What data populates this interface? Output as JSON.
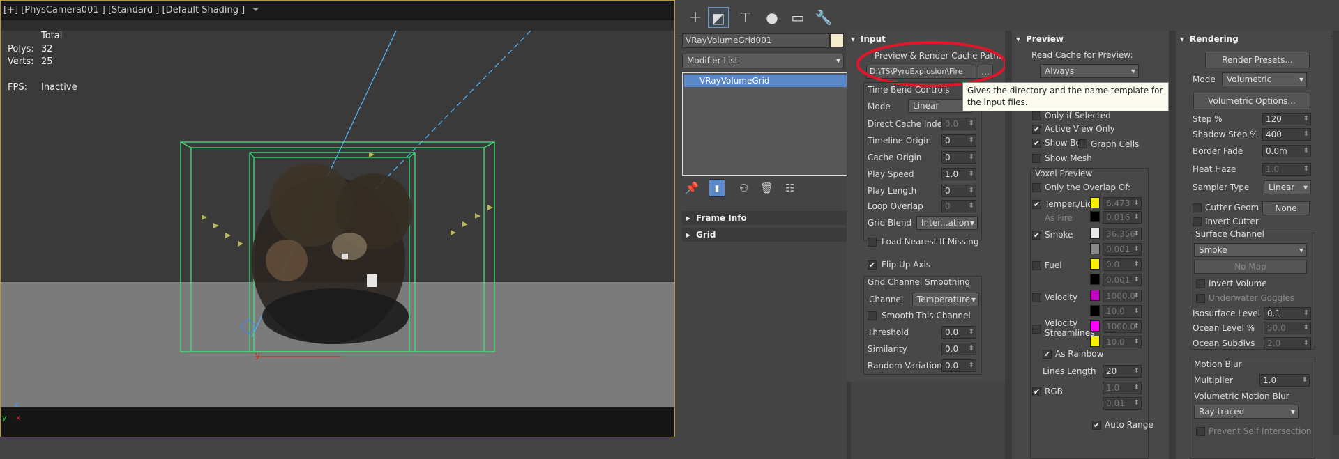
{
  "viewport": {
    "label": "[+] [PhysCamera001 ] [Standard ] [Default Shading ]",
    "stats_header": "Total",
    "polys_label": "Polys:",
    "polys": "32",
    "verts_label": "Verts:",
    "verts": "25",
    "fps_label": "FPS:",
    "fps": "Inactive",
    "axis_x": "x",
    "axis_y": "y",
    "axis_z": "z"
  },
  "modifier": {
    "object_name": "VRayVolumeGrid001",
    "color": "#f3ebcc",
    "list_label": "Modifier List",
    "stack_item": "VRayVolumeGrid",
    "rollouts": [
      "Frame Info",
      "Grid"
    ]
  },
  "input": {
    "title": "Input",
    "cache_path_label": "Preview & Render Cache Path:",
    "cache_path": "D:\\TS\\PyroExplosion\\Fire",
    "browse": "...",
    "tooltip": "Gives the directory and the name template for the input files.",
    "time_bend_title": "Time Bend Controls",
    "mode_label": "Mode",
    "mode": "Linear",
    "direct_cache_label": "Direct Cache Index",
    "direct_cache": "0.0",
    "timeline_origin_label": "Timeline Origin",
    "timeline_origin": "0",
    "cache_origin_label": "Cache Origin",
    "cache_origin": "0",
    "play_speed_label": "Play Speed",
    "play_speed": "1.0",
    "play_length_label": "Play Length",
    "play_length": "0",
    "loop_overlap_label": "Loop Overlap",
    "loop_overlap": "0",
    "grid_blend_label": "Grid Blend",
    "grid_blend": "Inter...ation",
    "load_nearest_label": "Load Nearest If Missing",
    "flip_up_label": "Flip Up Axis",
    "smoothing_title": "Grid Channel Smoothing",
    "channel_label": "Channel",
    "channel": "Temperature",
    "smooth_this_label": "Smooth This Channel",
    "threshold_label": "Threshold",
    "threshold": "0.0",
    "similarity_label": "Similarity",
    "similarity": "0.0",
    "random_var_label": "Random Variation",
    "random_var": "0.0"
  },
  "preview": {
    "title": "Preview",
    "read_cache_label": "Read Cache for Preview:",
    "read_cache": "Always",
    "only_if_selected": "Only if Selected",
    "active_view_only": "Active View Only",
    "show_box": "Show Box",
    "graph_cells": "Graph Cells",
    "show_mesh": "Show Mesh",
    "voxel_preview_title": "Voxel Preview",
    "only_overlap": "Only the Overlap Of:",
    "temper_label": "Temper./Liq.",
    "temper_val": "6.473",
    "as_fire": "As Fire",
    "as_fire_val": "0.016",
    "smoke_label": "Smoke",
    "smoke_val": "36.356",
    "smoke_val2": "0.001",
    "fuel_label": "Fuel",
    "fuel_val": "0.0",
    "fuel_val2": "0.001",
    "velocity_label": "Velocity",
    "velocity_val": "1000.0",
    "velocity_val2": "10.0",
    "vstream_label1": "Velocity",
    "vstream_label2": "Streamlines",
    "vstream_val": "1000.0",
    "vstream_val2": "10.0",
    "as_rainbow": "As Rainbow",
    "lines_length_label": "Lines Length",
    "lines_length": "20",
    "rgb_label": "RGB",
    "rgb_val": "1.0",
    "rgb_val2": "0.01",
    "auto_range": "Auto Range"
  },
  "rendering": {
    "title": "Rendering",
    "render_presets": "Render Presets...",
    "mode_label": "Mode",
    "mode": "Volumetric",
    "vol_options": "Volumetric Options...",
    "step_label": "Step %",
    "step": "120",
    "shadow_step_label": "Shadow Step %",
    "shadow_step": "400",
    "border_fade_label": "Border Fade",
    "border_fade": "0.0m",
    "heat_haze_label": "Heat Haze",
    "heat_haze": "1.0",
    "sampler_label": "Sampler Type",
    "sampler": "Linear",
    "cutter_geom_label": "Cutter Geom",
    "cutter_geom": "None",
    "invert_cutter": "Invert Cutter",
    "surface_channel_title": "Surface Channel",
    "surface_channel": "Smoke",
    "no_map": "No Map",
    "invert_volume": "Invert Volume",
    "underwater": "Underwater Goggles",
    "isosurface_label": "Isosurface Level",
    "isosurface": "0.1",
    "ocean_level_label": "Ocean Level %",
    "ocean_level": "50.0",
    "ocean_subdivs_label": "Ocean Subdivs",
    "ocean_subdivs": "2.0",
    "motion_blur_title": "Motion Blur",
    "multiplier_label": "Multiplier",
    "multiplier": "1.0",
    "vmb_label": "Volumetric Motion Blur",
    "vmb": "Ray-traced",
    "prevent_self": "Prevent Self Intersection"
  },
  "colors": {
    "temper": "#f5f000",
    "as_fire": "#000000",
    "smoke": "#e8e8e8",
    "smoke2": "#888888",
    "fuel": "#f5f000",
    "fuel2": "#000000",
    "velocity": "#c000c0",
    "velocity2": "#000000",
    "vstream": "#ff00ff",
    "vstream2": "#f5f000",
    "annotation": "#e0162b"
  }
}
